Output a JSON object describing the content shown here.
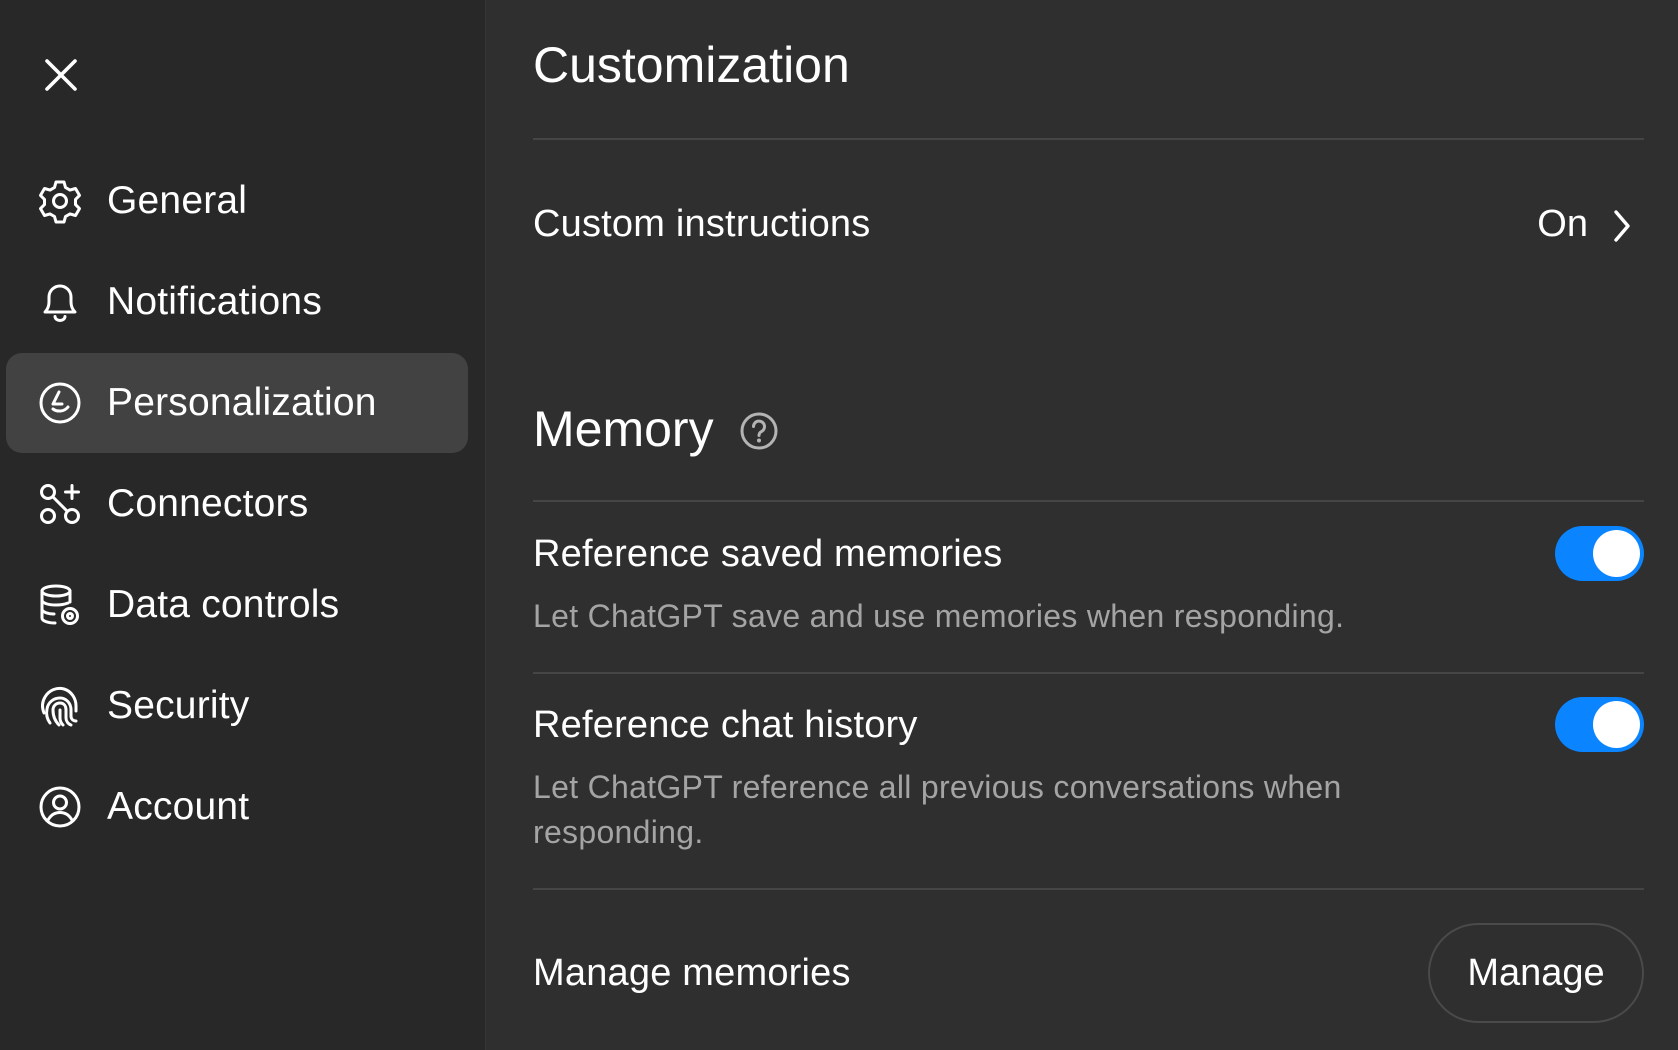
{
  "sidebar": {
    "close_icon": "close-icon",
    "items": [
      {
        "label": "General",
        "icon": "gear-icon",
        "active": false
      },
      {
        "label": "Notifications",
        "icon": "bell-icon",
        "active": false
      },
      {
        "label": "Personalization",
        "icon": "personalization-icon",
        "active": true
      },
      {
        "label": "Connectors",
        "icon": "connectors-icon",
        "active": false
      },
      {
        "label": "Data controls",
        "icon": "database-gear-icon",
        "active": false
      },
      {
        "label": "Security",
        "icon": "fingerprint-icon",
        "active": false
      },
      {
        "label": "Account",
        "icon": "user-circle-icon",
        "active": false
      }
    ]
  },
  "main": {
    "title": "Customization",
    "custom_instructions": {
      "label": "Custom instructions",
      "value": "On",
      "icon": "chevron-right-icon"
    },
    "memory": {
      "title": "Memory",
      "help_icon": "help-circle-icon",
      "settings": [
        {
          "title": "Reference saved memories",
          "description": "Let ChatGPT save and use memories when responding.",
          "enabled": true
        },
        {
          "title": "Reference chat history",
          "description": "Let ChatGPT reference all previous conversations when responding.",
          "enabled": true
        }
      ],
      "manage": {
        "label": "Manage memories",
        "button_label": "Manage"
      }
    }
  },
  "colors": {
    "background": "#2f2f2f",
    "sidebar_background": "#282828",
    "active_item": "#424242",
    "toggle_on": "#0a84ff",
    "secondary_text": "#a4a4a4",
    "divider": "#454545"
  }
}
